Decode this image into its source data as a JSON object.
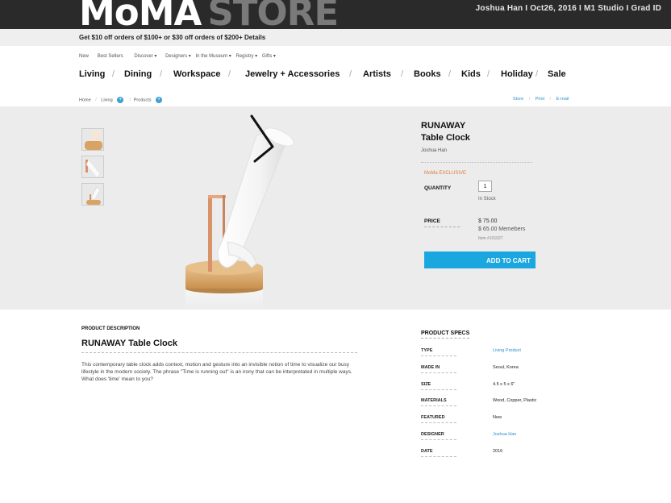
{
  "brand": {
    "logo_moma": "MoMA",
    "logo_store": "STORE"
  },
  "topbar": {
    "meta": "Joshua Han  I  Oct26, 2016  I  M1 Studio  I  Grad ID"
  },
  "promo": {
    "text": "Get $10 off orders of $100+ or $30 off orders of $200+ Details"
  },
  "util_nav": [
    "New",
    "Best Sellers",
    "Discover ▾",
    "Designers ▾",
    "In the Museum ▾",
    "Registry ▾",
    "Gifts ▾"
  ],
  "main_nav": [
    "Living",
    "Dining",
    "Workspace",
    "Jewelry + Accessories",
    "Artists",
    "Books",
    "Kids",
    "Holiday",
    "Sale"
  ],
  "nav_separator": "/",
  "breadcrumb": {
    "home": "Home",
    "sep": "/",
    "living": "Living",
    "products": "Products",
    "plus": "+"
  },
  "share": {
    "store": "Store",
    "sep": "/",
    "print": "Print",
    "email": "E-mail"
  },
  "product": {
    "title_line1": "RUNAWAY",
    "title_line2": "Table Clock",
    "designer": "Joshua Han",
    "badge": "MoMa EXCLUSIVE",
    "quantity_label": "QUANTITY",
    "quantity_value": "1",
    "stock": "In Stock",
    "price_label": "PRICE",
    "price": "$ 75.00",
    "member_price": "$ 65.00 Memebers",
    "item_no": "Item #101027",
    "cart_button": "ADD TO CART"
  },
  "description": {
    "label": "PRODUCT DESCRIPTION",
    "title": "RUNAWAY Table Clock",
    "text": "This contemporary table clock adds context, motion and gesture into an invisible notion of time to visualize our busy lifestyle in the modern society. The phrase \"Time is running out\" is an irony that can be interpretated in multiple ways. What does 'time' mean to you?"
  },
  "specs": {
    "label": "PRODUCT SPECS",
    "rows": [
      {
        "key": "TYPE",
        "value": "Living Product",
        "link": true
      },
      {
        "key": "MADE IN",
        "value": "Seoul, Korea",
        "link": false
      },
      {
        "key": "SIZE",
        "value": "4.5 x 5 x 6\"",
        "link": false
      },
      {
        "key": "MATERIALS",
        "value": "Wood, Copper, Plastic",
        "link": false
      },
      {
        "key": "FEATURED",
        "value": "New",
        "link": false
      },
      {
        "key": "DESIGNER",
        "value": "Joshua Han",
        "link": true
      },
      {
        "key": "DATE",
        "value": "2016",
        "link": false
      }
    ]
  },
  "colors": {
    "accent_blue": "#1aa7e0",
    "exclusive_orange": "#e07a3c",
    "topbar": "#2a2a2a",
    "wood": "#d9aa6a",
    "copper": "#d9926a"
  },
  "icons": {
    "thumb_1": "clock-base-thumbnail",
    "thumb_2": "clock-tube-thumbnail",
    "thumb_3": "clock-full-thumbnail"
  }
}
